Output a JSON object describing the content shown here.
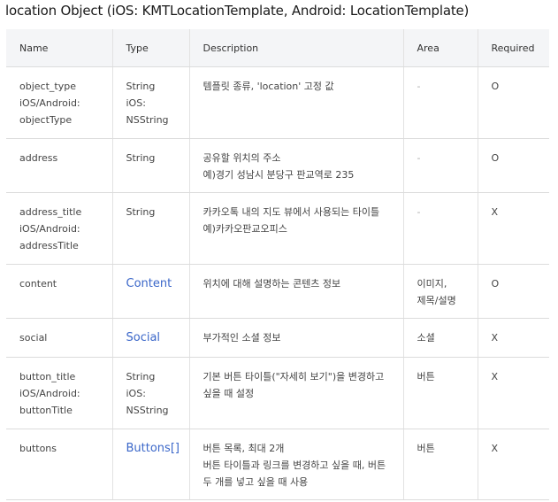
{
  "title": "location Object (iOS: KMTLocationTemplate, Android: LocationTemplate)",
  "columns": [
    "Name",
    "Type",
    "Description",
    "Area",
    "Required"
  ],
  "rows": [
    {
      "name": [
        "object_type",
        "iOS/Android:",
        "objectType"
      ],
      "type": [
        "String",
        "iOS:",
        "NSString"
      ],
      "description": [
        "템플릿 종류, 'location' 고정 값"
      ],
      "area": [
        "-"
      ],
      "required": "O"
    },
    {
      "name": [
        "address"
      ],
      "type": [
        "String"
      ],
      "description": [
        "공유할 위치의 주소",
        "예)경기 성남시 분당구 판교역로 235"
      ],
      "area": [
        "-"
      ],
      "required": "O"
    },
    {
      "name": [
        "address_title",
        "iOS/Android:",
        "addressTitle"
      ],
      "type": [
        "String"
      ],
      "description": [
        "카카오톡 내의 지도 뷰에서 사용되는 타이틀",
        "예)카카오판교오피스"
      ],
      "area": [
        "-"
      ],
      "required": "X"
    },
    {
      "name": [
        "content"
      ],
      "type_link": "Content",
      "description": [
        "위치에 대해 설명하는 콘텐츠 정보"
      ],
      "area": [
        "이미지,",
        "제목/설명"
      ],
      "required": "O"
    },
    {
      "name": [
        "social"
      ],
      "type_link": "Social",
      "description": [
        "부가적인 소셜 정보"
      ],
      "area": [
        "소셜"
      ],
      "required": "X"
    },
    {
      "name": [
        "button_title",
        "iOS/Android:",
        "buttonTitle"
      ],
      "type": [
        "String",
        "iOS:",
        "NSString"
      ],
      "description": [
        "기본 버튼 타이틀(\"자세히 보기\")을 변경하고",
        "싶을 때 설정"
      ],
      "area": [
        "버튼"
      ],
      "required": "X"
    },
    {
      "name": [
        "buttons"
      ],
      "type_link": "Buttons[]",
      "description": [
        "버튼 목록, 최대 2개",
        "버튼 타이틀과 링크를 변경하고 싶을 때, 버튼",
        "두 개를 넣고 싶을 때 사용"
      ],
      "area": [
        "버튼"
      ],
      "required": "X"
    }
  ]
}
